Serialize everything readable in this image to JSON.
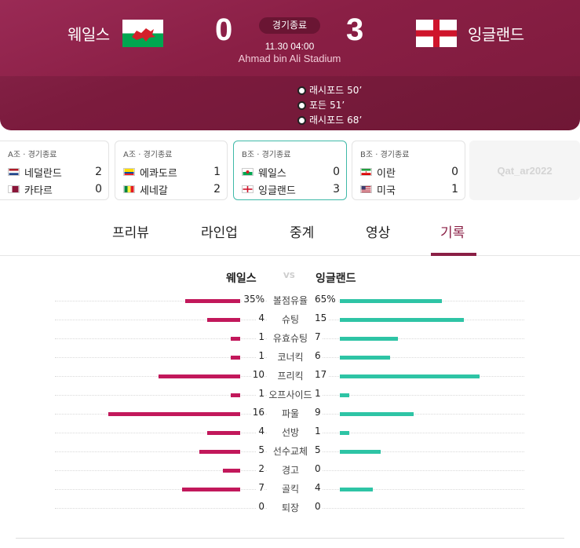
{
  "match": {
    "home": {
      "name": "웨일스",
      "score": "0"
    },
    "away": {
      "name": "잉글랜드",
      "score": "3"
    },
    "status": "경기종료",
    "time": "11.30 04:00",
    "venue": "Ahmad bin Ali Stadium",
    "goals": [
      {
        "player": "래시포드",
        "minute": "50’"
      },
      {
        "player": "포든",
        "minute": "51’"
      },
      {
        "player": "래시포드",
        "minute": "68’"
      }
    ]
  },
  "other_matches": [
    {
      "group": "A조 · 경기종료",
      "home": "네덜란드",
      "home_score": "2",
      "away": "카타르",
      "away_score": "0"
    },
    {
      "group": "A조 · 경기종료",
      "home": "에콰도르",
      "home_score": "1",
      "away": "세네갈",
      "away_score": "2"
    },
    {
      "group": "B조 · 경기종료",
      "home": "웨일스",
      "home_score": "0",
      "away": "잉글랜드",
      "away_score": "3"
    },
    {
      "group": "B조 · 경기종료",
      "home": "이란",
      "home_score": "0",
      "away": "미국",
      "away_score": "1"
    }
  ],
  "logo_text": "Qat_ar2022",
  "tabs": [
    "프리뷰",
    "라인업",
    "중계",
    "영상",
    "기록"
  ],
  "active_tab": "기록",
  "stats": {
    "home_label": "웨일스",
    "away_label": "잉글랜드",
    "vs": "VS",
    "rows": [
      {
        "label": "볼점유율",
        "home": "35%",
        "away": "65%",
        "home_frac": 0.35,
        "away_frac": 0.65
      },
      {
        "label": "슈팅",
        "home": "4",
        "away": "15",
        "home_frac": 0.21,
        "away_frac": 0.79
      },
      {
        "label": "유효슈팅",
        "home": "1",
        "away": "7",
        "home_frac": 0.05,
        "away_frac": 0.37
      },
      {
        "label": "코너킥",
        "home": "1",
        "away": "6",
        "home_frac": 0.05,
        "away_frac": 0.32
      },
      {
        "label": "프리킥",
        "home": "10",
        "away": "17",
        "home_frac": 0.52,
        "away_frac": 0.89
      },
      {
        "label": "오프사이드",
        "home": "1",
        "away": "1",
        "home_frac": 0.05,
        "away_frac": 0.05
      },
      {
        "label": "파울",
        "home": "16",
        "away": "9",
        "home_frac": 0.84,
        "away_frac": 0.47
      },
      {
        "label": "선방",
        "home": "4",
        "away": "1",
        "home_frac": 0.21,
        "away_frac": 0.05
      },
      {
        "label": "선수교체",
        "home": "5",
        "away": "5",
        "home_frac": 0.26,
        "away_frac": 0.26
      },
      {
        "label": "경고",
        "home": "2",
        "away": "0",
        "home_frac": 0.11,
        "away_frac": 0
      },
      {
        "label": "골킥",
        "home": "7",
        "away": "4",
        "home_frac": 0.37,
        "away_frac": 0.21
      },
      {
        "label": "퇴장",
        "home": "0",
        "away": "0",
        "home_frac": 0,
        "away_frac": 0
      }
    ]
  }
}
